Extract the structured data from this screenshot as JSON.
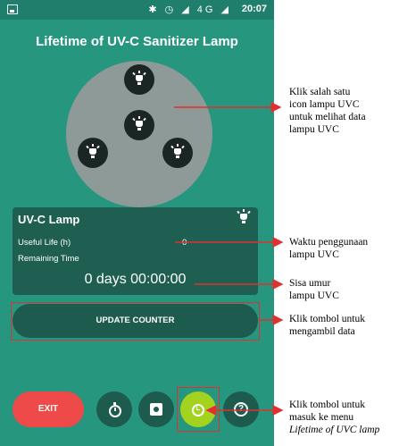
{
  "status_bar": {
    "indicators": "✱ ◷ ◢ 4G ◢",
    "time": "20:07"
  },
  "app": {
    "title": "Lifetime of UV-C Sanitizer Lamp"
  },
  "lamp_selector": {
    "lamps": [
      {
        "icon": "lamp-icon"
      },
      {
        "icon": "lamp-icon"
      },
      {
        "icon": "lamp-icon"
      },
      {
        "icon": "lamp-icon"
      }
    ]
  },
  "info_card": {
    "title": "UV-C Lamp",
    "icon": "lamp-icon",
    "useful_life_label": "Useful Life (h)",
    "useful_life_value": "0",
    "remaining_time_label": "Remaining Time",
    "remaining_time_value": "0 days 00:00:00"
  },
  "buttons": {
    "update_counter": "UPDATE COUNTER",
    "exit": "EXIT",
    "stopwatch_icon": "stopwatch-icon",
    "settings_icon": "settings-icon",
    "lifetime_icon": "timer-icon",
    "help_icon": "help-icon"
  },
  "annotations": {
    "lamp_select": [
      "Klik salah satu",
      "icon lampu UVC",
      "untuk melihat data",
      "lampu UVC"
    ],
    "usage_time": [
      "Waktu penggunaan",
      "lampu UVC"
    ],
    "remaining_life": [
      "Sisa umur",
      "lampu UVC"
    ],
    "update_button": [
      "Klik tombol untuk",
      "mengambil data"
    ],
    "lifetime_menu": [
      "Klik tombol untuk",
      "masuk ke menu",
      "Lifetime of UVC lamp"
    ]
  },
  "colors": {
    "screen_background": "#27967f",
    "status_bar": "#1f7f6c",
    "card_background": "#1f5f52",
    "lamp_circle": "#8e9a97",
    "exit_button": "#ee4a4a",
    "lifetime_button": "#a3d21f",
    "highlight_outline": "#e03030"
  }
}
